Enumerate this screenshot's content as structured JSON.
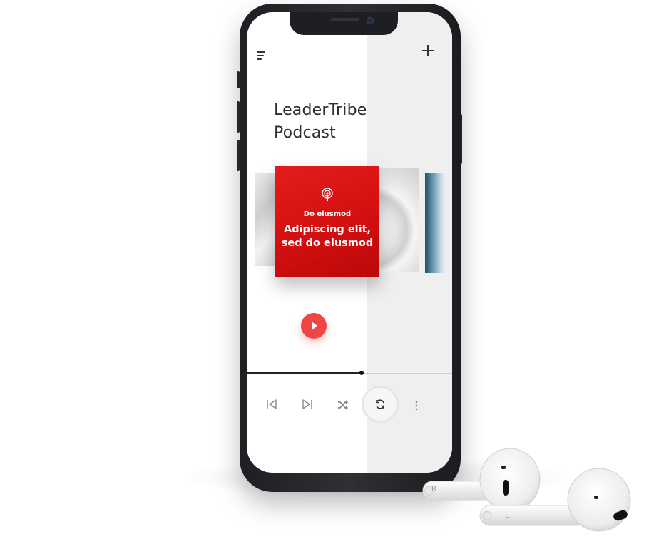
{
  "app": {
    "title": "LeaderTribe Podcast",
    "title_line1": "LeaderTribe",
    "title_line2": "Podcast"
  },
  "toolbar": {
    "menu_icon": "menu-icon",
    "add_icon": "plus-icon"
  },
  "featured": {
    "icon": "podcast-icon",
    "kicker": "Do eiusmod",
    "headline": "Adipiscing elit, sed do eiusmod",
    "accent_color": "#d91414"
  },
  "player": {
    "play_icon": "play-icon",
    "play_color": "#f04545",
    "progress": 0.56,
    "controls": [
      "previous-icon",
      "next-icon",
      "shuffle-icon",
      "repeat-icon",
      "more-vertical-icon"
    ]
  },
  "earbuds": {
    "left_label": "R",
    "right_label": "L"
  }
}
